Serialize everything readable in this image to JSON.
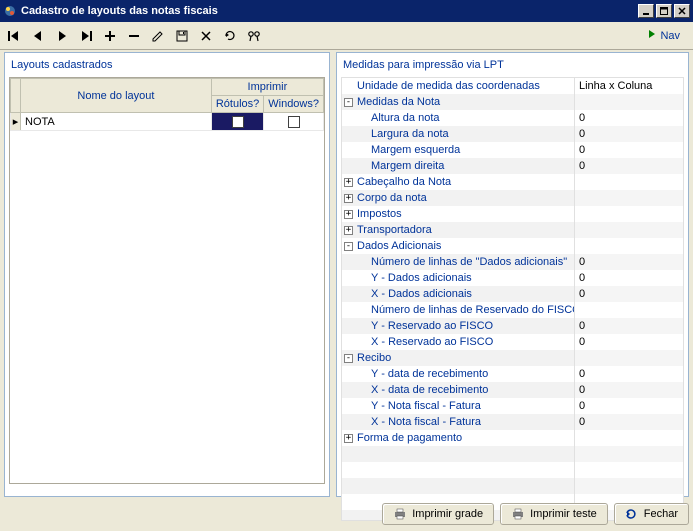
{
  "window": {
    "title": "Cadastro de layouts das notas fiscais"
  },
  "toolbar": {
    "nav_label": "Nav"
  },
  "leftPanel": {
    "title": "Layouts cadastrados",
    "col_name": "Nome do layout",
    "col_print": "Imprimir",
    "col_labels": "Rótulos?",
    "col_windows": "Windows?",
    "rows": [
      {
        "name": "NOTA",
        "labels": false,
        "windows": false
      }
    ]
  },
  "rightPanel": {
    "title": "Medidas para impressão via LPT",
    "rows": [
      {
        "type": "leaf",
        "indent": 1,
        "label": "Unidade de medida das coordenadas",
        "value": "Linha x Coluna"
      },
      {
        "type": "group",
        "state": "-",
        "label": "Medidas da Nota",
        "value": ""
      },
      {
        "type": "leaf",
        "indent": 2,
        "label": "Altura da nota",
        "value": "0"
      },
      {
        "type": "leaf",
        "indent": 2,
        "label": "Largura da nota",
        "value": "0"
      },
      {
        "type": "leaf",
        "indent": 2,
        "label": "Margem esquerda",
        "value": "0"
      },
      {
        "type": "leaf",
        "indent": 2,
        "label": "Margem direita",
        "value": "0"
      },
      {
        "type": "group",
        "state": "+",
        "label": "Cabeçalho da Nota",
        "value": ""
      },
      {
        "type": "group",
        "state": "+",
        "label": "Corpo da nota",
        "value": ""
      },
      {
        "type": "group",
        "state": "+",
        "label": "Impostos",
        "value": ""
      },
      {
        "type": "group",
        "state": "+",
        "label": "Transportadora",
        "value": ""
      },
      {
        "type": "group",
        "state": "-",
        "label": "Dados Adicionais",
        "value": ""
      },
      {
        "type": "leaf",
        "indent": 2,
        "label": "Número de linhas de \"Dados adicionais\"",
        "value": "0"
      },
      {
        "type": "leaf",
        "indent": 2,
        "label": "Y -  Dados adicionais",
        "value": "0"
      },
      {
        "type": "leaf",
        "indent": 2,
        "label": "X - Dados adicionais",
        "value": "0"
      },
      {
        "type": "leaf",
        "indent": 2,
        "label": "Número de linhas de Reservado do FISCO",
        "value": ""
      },
      {
        "type": "leaf",
        "indent": 2,
        "label": "Y - Reservado ao FISCO",
        "value": "0"
      },
      {
        "type": "leaf",
        "indent": 2,
        "label": "X - Reservado ao FISCO",
        "value": "0"
      },
      {
        "type": "group",
        "state": "-",
        "label": "Recibo",
        "value": ""
      },
      {
        "type": "leaf",
        "indent": 2,
        "label": "Y - data de recebimento",
        "value": "0"
      },
      {
        "type": "leaf",
        "indent": 2,
        "label": "X - data de recebimento",
        "value": "0"
      },
      {
        "type": "leaf",
        "indent": 2,
        "label": "Y - Nota fiscal - Fatura",
        "value": "0"
      },
      {
        "type": "leaf",
        "indent": 2,
        "label": "X - Nota fiscal - Fatura",
        "value": "0"
      },
      {
        "type": "group",
        "state": "+",
        "label": "Forma de pagamento",
        "value": ""
      }
    ]
  },
  "buttons": {
    "print_grid": "Imprimir grade",
    "print_test": "Imprimir teste",
    "close": "Fechar"
  }
}
